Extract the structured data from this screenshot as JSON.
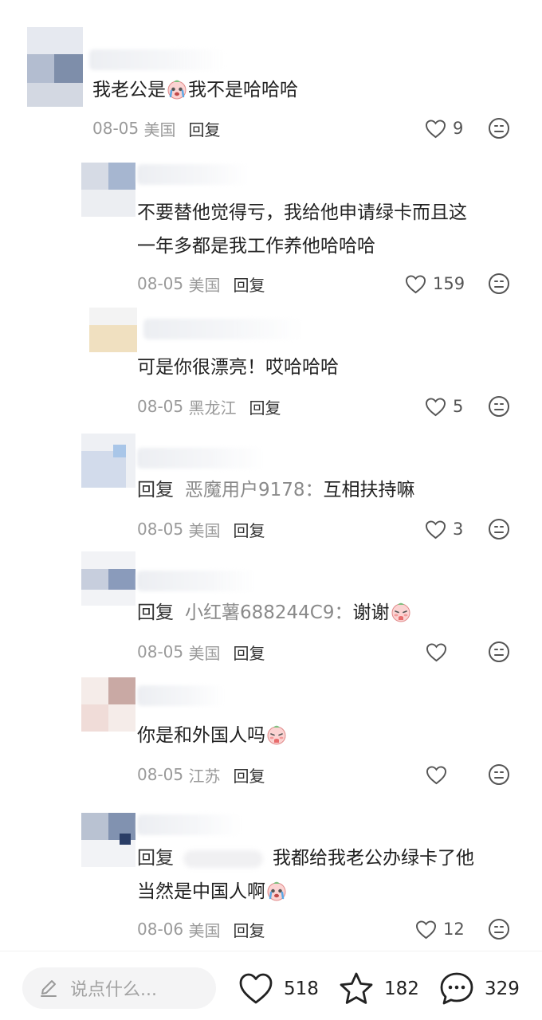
{
  "comments": [
    {
      "text": "我老公是",
      "text_tail": "我不是哈哈哈",
      "date": "08-05",
      "region": "美国",
      "reply_label": "回复",
      "likes": "9"
    },
    {
      "text": "不要替他觉得亏，我给他申请绿卡而且这",
      "text2": "一年多都是我工作养他哈哈哈",
      "date": "08-05",
      "region": "美国",
      "reply_label": "回复",
      "likes": "159"
    },
    {
      "text": "可是你很漂亮！哎哈哈哈",
      "date": "08-05",
      "region": "黑龙江",
      "reply_label": "回复",
      "likes": "5"
    },
    {
      "reply_prefix": "回复",
      "reply_to": "恶魔用户9178：",
      "text": "互相扶持嘛",
      "date": "08-05",
      "region": "美国",
      "reply_label": "回复",
      "likes": "3"
    },
    {
      "reply_prefix": "回复",
      "reply_to": "小红薯688244C9：",
      "text": "谢谢",
      "date": "08-05",
      "region": "美国",
      "reply_label": "回复",
      "likes": ""
    },
    {
      "text": "你是和外国人吗",
      "date": "08-05",
      "region": "江苏",
      "reply_label": "回复",
      "likes": ""
    },
    {
      "reply_prefix": "回复",
      "text": "我都给我老公办绿卡了他",
      "text2": "当然是中国人啊",
      "date": "08-06",
      "region": "美国",
      "reply_label": "回复",
      "likes": "12"
    }
  ],
  "bottom_bar": {
    "input_placeholder": "说点什么...",
    "like_count": "518",
    "star_count": "182",
    "comment_count": "329"
  },
  "icons": [
    "heart-icon",
    "smile-reaction-icon",
    "pencil-icon",
    "star-icon",
    "chat-bubble-icon",
    "crying-emoji",
    "shy-emoji"
  ],
  "colors": {
    "text": "#222222",
    "muted": "#9a9a9a",
    "reply_name": "#8a8a8a",
    "input_bg": "#f4f4f5"
  }
}
